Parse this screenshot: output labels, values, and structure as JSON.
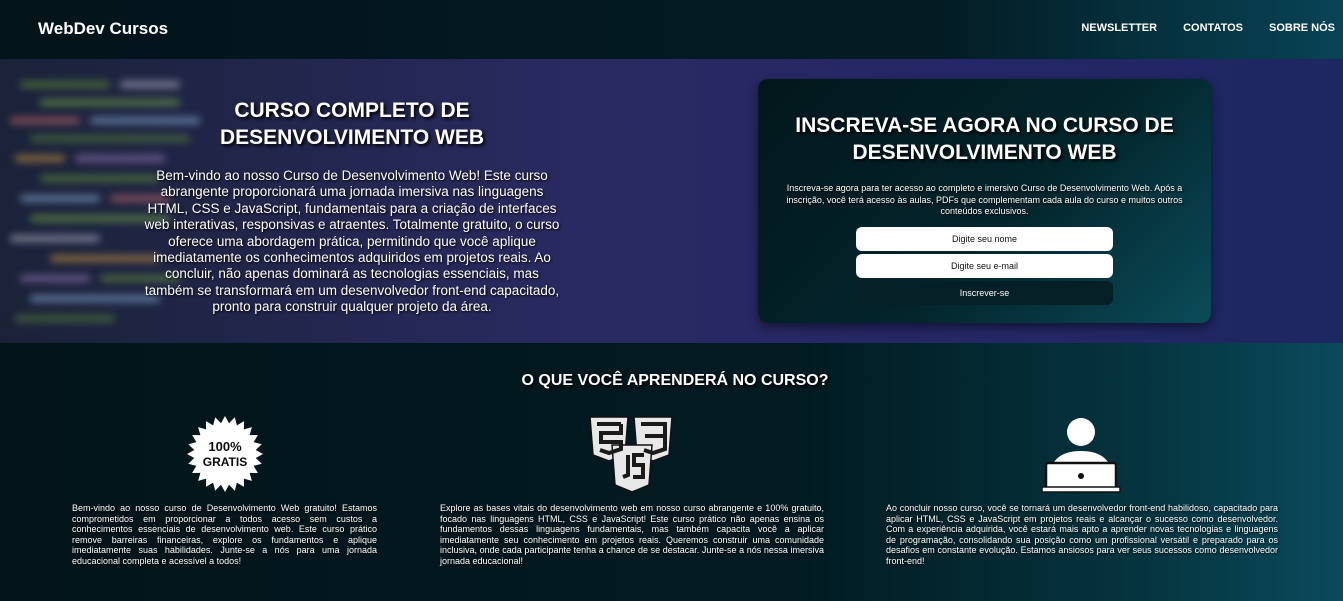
{
  "header": {
    "brand": "WebDev Cursos",
    "nav": [
      "NEWSLETTER",
      "CONTATOS",
      "SOBRE NÓS"
    ]
  },
  "hero": {
    "title": "CURSO COMPLETO DE DESENVOLVIMENTO WEB",
    "text": "Bem-vindo ao nosso Curso de Desenvolvimento Web! Este curso abrangente proporcionará uma jornada imersiva nas linguagens HTML, CSS e JavaScript, fundamentais para a criação de interfaces web interativas, responsivas e atraentes. Totalmente gratuito, o curso oferece uma abordagem prática, permitindo que você aplique imediatamente os conhecimentos adquiridos em projetos reais. Ao concluir, não apenas dominará as tecnologias essenciais, mas também se transformará em um desenvolvedor front-end capacitado, pronto para construir qualquer projeto da área."
  },
  "signup": {
    "title": "INSCREVA-SE AGORA NO CURSO DE DESENVOLVIMENTO WEB",
    "text": "Inscreva-se agora para ter acesso ao completo e imersivo Curso de Desenvolvimento Web. Após a inscrição, você terá acesso às aulas, PDFs que complementam cada aula do curso e muitos outros conteúdos exclusivos.",
    "name_placeholder": "Digite seu nome",
    "email_placeholder": "Digite seu e-mail",
    "button_label": "Inscrever-se"
  },
  "features": {
    "title": "O QUE VOCÊ APRENDERÁ NO CURSO?",
    "items": [
      {
        "icon": "free-badge-icon",
        "badge_line1": "100%",
        "badge_line2": "GRATIS",
        "text": "Bem-vindo ao nosso curso de Desenvolvimento Web gratuito! Estamos comprometidos em proporcionar a todos acesso sem custos a conhecimentos essenciais de desenvolvimento web. Este curso prático remove barreiras financeiras, explore os fundamentos e aplique imediatamente suas habilidades. Junte-se a nós para uma jornada educacional completa e acessível a todos!"
      },
      {
        "icon": "html-css-js-icon",
        "text": "Explore as bases vitais do desenvolvimento web em nosso curso abrangente e 100% gratuito, focado nas linguagens HTML, CSS e JavaScript! Este curso prático não apenas ensina os fundamentos dessas linguagens fundamentais, mas também capacita você a aplicar imediatamente seu conhecimento em projetos reais. Queremos construir uma comunidade inclusiva, onde cada participante tenha a chance de se destacar. Junte-se a nós nessa imersiva jornada educacional!"
      },
      {
        "icon": "developer-laptop-icon",
        "text": "Ao concluir nosso curso, você se tornará um desenvolvedor front-end habilidoso, capacitado para aplicar HTML, CSS e JavaScript em projetos reais e alcançar o sucesso como desenvolvedor. Com a experiência adquirida, você estará mais apto a aprender novas tecnologias e linguagens de programação, consolidando sua posição como um profissional versátil e preparado para os desafios em constante evolução. Estamos ansiosos para ver seus sucessos como desenvolvedor front-end!"
      }
    ]
  }
}
